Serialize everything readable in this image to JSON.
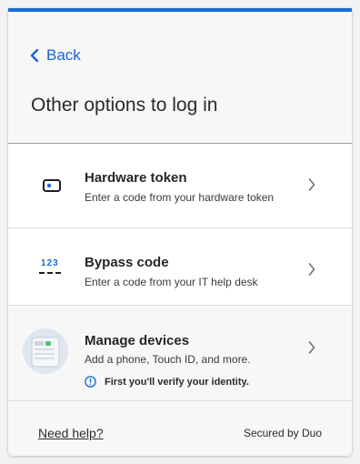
{
  "header": {
    "back_label": "Back",
    "title": "Other options to log in"
  },
  "options": [
    {
      "title": "Hardware token",
      "description": "Enter a code from your hardware token",
      "icon": "hardware-token-icon"
    },
    {
      "title": "Bypass code",
      "description": "Enter a code from your IT help desk",
      "icon": "bypass-code-icon",
      "icon_text": "123"
    },
    {
      "title": "Manage devices",
      "description": "Add a phone, Touch ID, and more.",
      "note": "First you'll verify your identity.",
      "icon": "manage-devices-icon"
    }
  ],
  "footer": {
    "help_label": "Need help?",
    "secured_label": "Secured by Duo"
  },
  "colors": {
    "accent": "#1a6ad6",
    "link": "#1565d8"
  }
}
